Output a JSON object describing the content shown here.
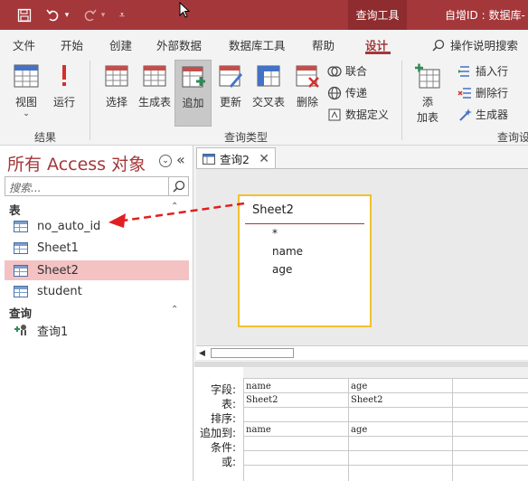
{
  "titlebar": {
    "context_tab": "查询工具",
    "title": "自增ID : 数据库-"
  },
  "tabs": {
    "file": "文件",
    "home": "开始",
    "create": "创建",
    "external": "外部数据",
    "dbtools": "数据库工具",
    "help": "帮助",
    "design": "设计",
    "tellme": "操作说明搜索"
  },
  "ribbon": {
    "view": "视图",
    "run": "运行",
    "select": "选择",
    "make_table": "生成表",
    "append": "追加",
    "update": "更新",
    "crosstab": "交叉表",
    "delete": "删除",
    "union": "联合",
    "passthrough": "传递",
    "data_definition": "数据定义",
    "add_table_line1": "添",
    "add_table_line2": "加表",
    "insert_row": "插入行",
    "delete_row": "删除行",
    "builder": "生成器",
    "group_results": "结果",
    "group_query_type": "查询类型",
    "group_setup": "查询设"
  },
  "nav": {
    "title": "所有 Access 对象",
    "search_placeholder": "搜索...",
    "group_tables": "表",
    "tables": [
      "no_auto_id",
      "Sheet1",
      "Sheet2",
      "student"
    ],
    "group_queries": "查询",
    "queries": [
      "查询1"
    ]
  },
  "doc": {
    "tab_label": "查询2",
    "table_box": {
      "name": "Sheet2",
      "fields": [
        "*",
        "name",
        "age"
      ]
    },
    "grid": {
      "row_labels": [
        "字段:",
        "表:",
        "排序:",
        "追加到:",
        "条件:",
        "或:"
      ],
      "columns": [
        {
          "field": "name",
          "table": "Sheet2",
          "sort": "",
          "append_to": "name"
        },
        {
          "field": "age",
          "table": "Sheet2",
          "sort": "",
          "append_to": "age"
        }
      ]
    }
  },
  "colors": {
    "accent": "#a4373a",
    "selection": "#f4c2c3",
    "table_box_border": "#f0c130",
    "annotation_arrow": "#e02020"
  }
}
